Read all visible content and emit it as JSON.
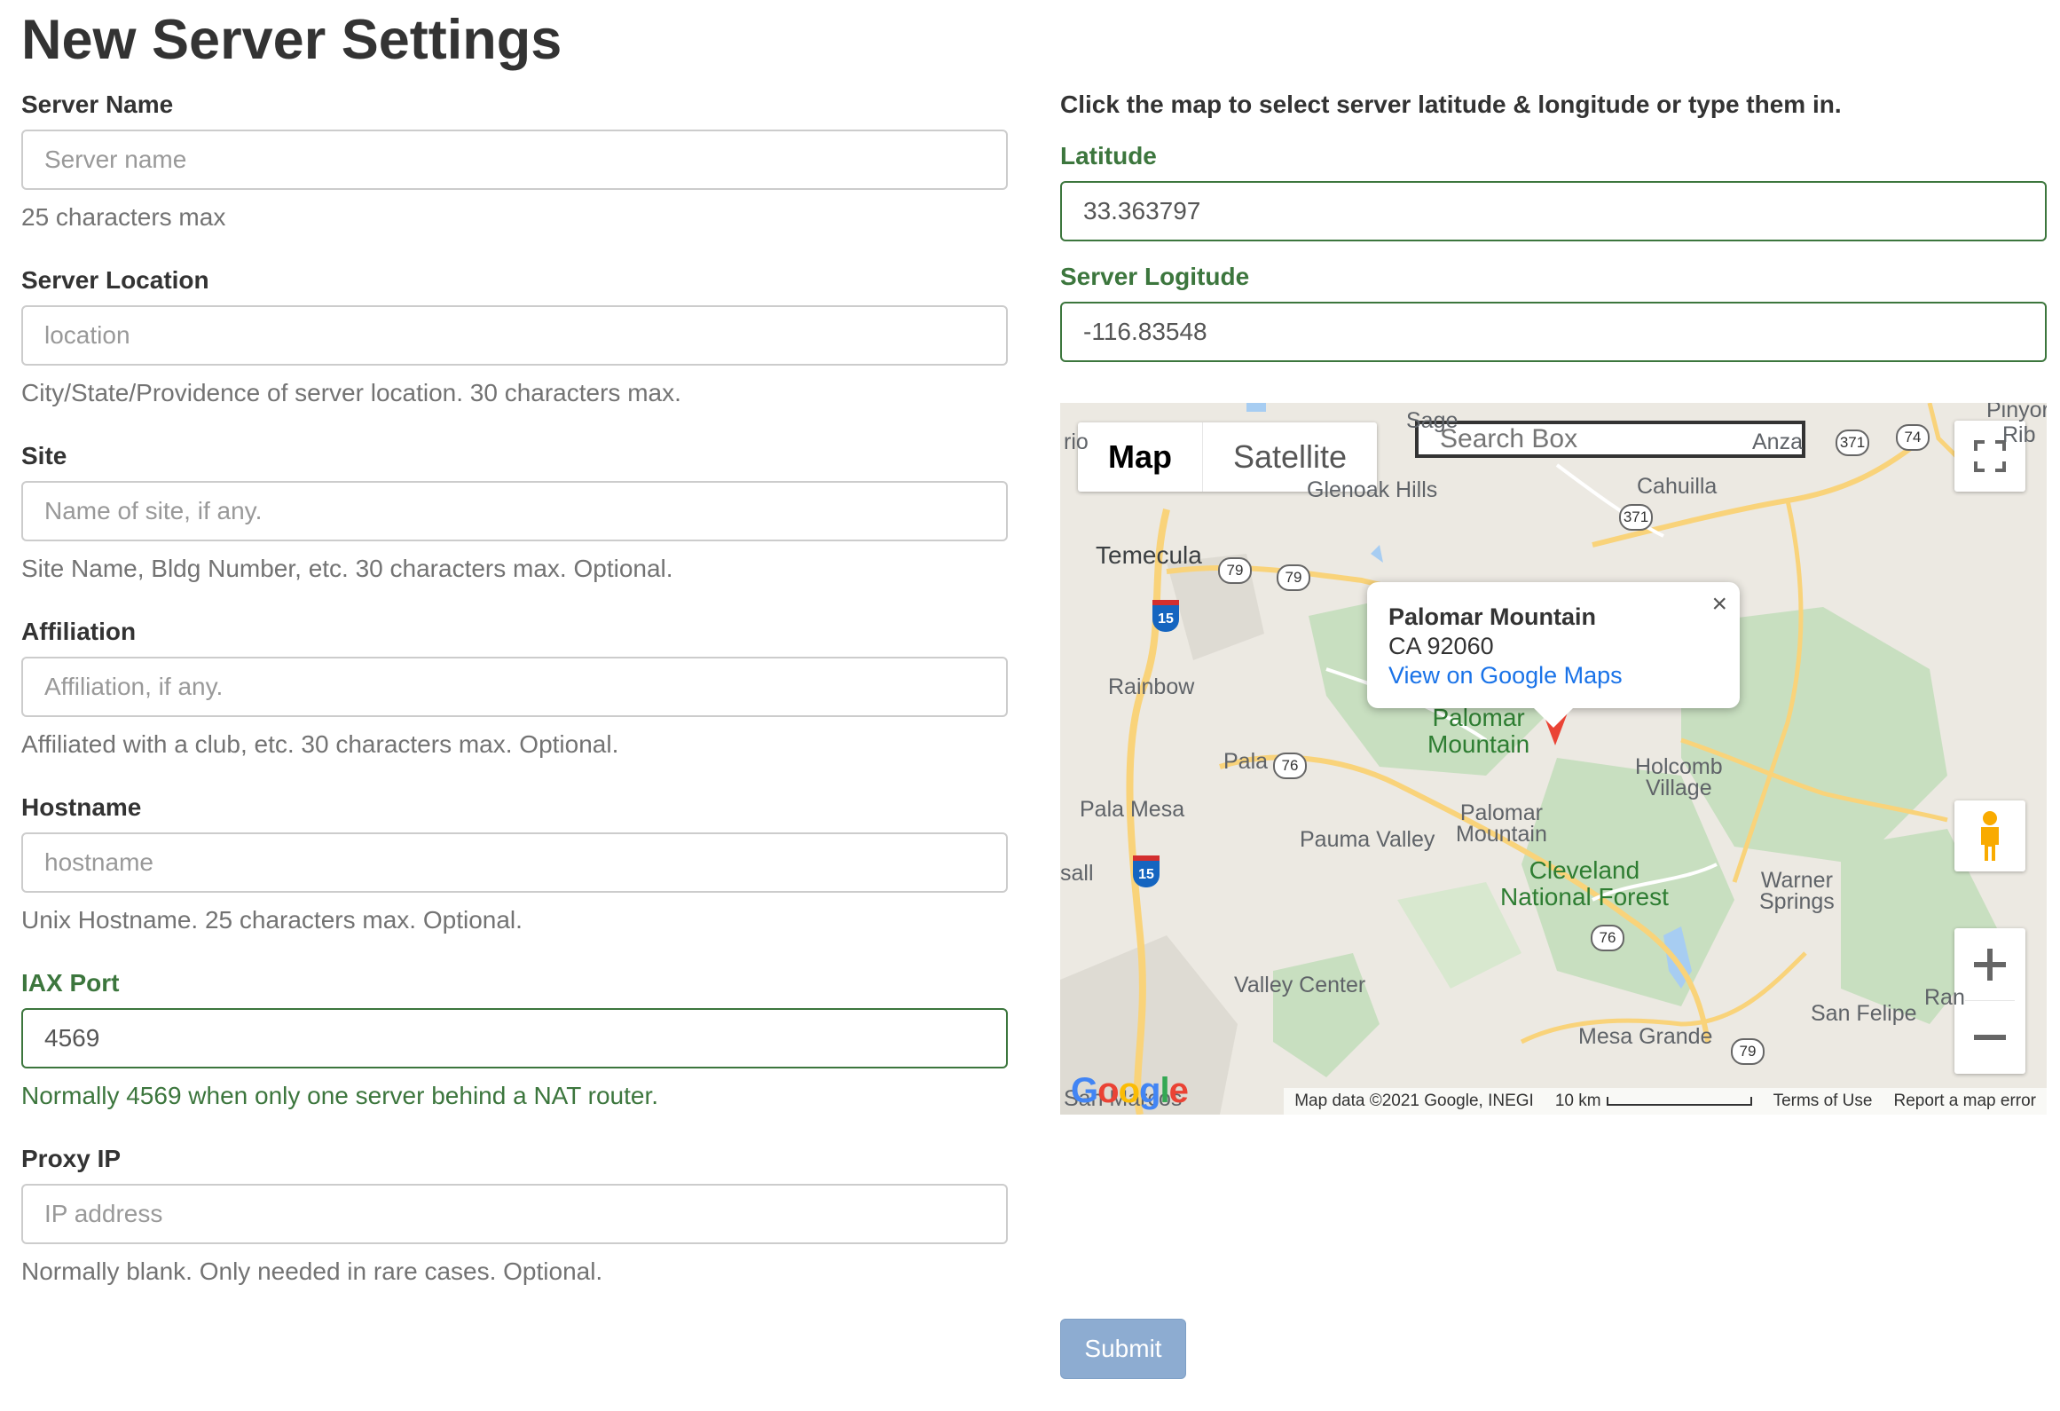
{
  "page": {
    "title": "New Server Settings"
  },
  "form": {
    "server_name": {
      "label": "Server Name",
      "placeholder": "Server name",
      "help": "25 characters max"
    },
    "server_location": {
      "label": "Server Location",
      "placeholder": "location",
      "help": "City/State/Providence of server location. 30 characters max."
    },
    "site": {
      "label": "Site",
      "placeholder": "Name of site, if any.",
      "help": "Site Name, Bldg Number, etc. 30 characters max. Optional."
    },
    "affiliation": {
      "label": "Affiliation",
      "placeholder": "Affiliation, if any.",
      "help": "Affiliated with a club, etc. 30 characters max. Optional."
    },
    "hostname": {
      "label": "Hostname",
      "placeholder": "hostname",
      "help": "Unix Hostname. 25 characters max. Optional."
    },
    "iax_port": {
      "label": "IAX Port",
      "value": "4569",
      "help": "Normally 4569 when only one server behind a NAT router."
    },
    "proxy_ip": {
      "label": "Proxy IP",
      "placeholder": "IP address",
      "help": "Normally blank. Only needed in rare cases. Optional."
    },
    "submit_label": "Submit"
  },
  "map_panel": {
    "intro": "Click the map to select server latitude & longitude or type them in.",
    "latitude": {
      "label": "Latitude",
      "value": "33.363797"
    },
    "longitude": {
      "label": "Server Logitude",
      "value": "-116.83548"
    }
  },
  "map": {
    "type_map": "Map",
    "type_satellite": "Satellite",
    "search_placeholder": "Search Box",
    "infowindow": {
      "name": "Palomar Mountain",
      "address": "CA 92060",
      "link": "View on Google Maps",
      "close": "×"
    },
    "labels": {
      "temecula": "Temecula",
      "cahuilla": "Cahuilla",
      "anza": "Anza",
      "sage": "Sage",
      "glenoak": "Glenoak Hills",
      "rainbow": "Rainbow",
      "pala": "Pala",
      "pala_mesa": "Pala Mesa",
      "palomar_mountain_1": "Palomar",
      "palomar_mountain_2": "Mountain",
      "palomar_small_1": "Palomar",
      "palomar_small_2": "Mountain",
      "holcomb_1": "Holcomb",
      "holcomb_2": "Village",
      "pauma_valley": "Pauma Valley",
      "cleveland_1": "Cleveland",
      "cleveland_2": "National Forest",
      "warner_1": "Warner",
      "warner_2": "Springs",
      "valley_center": "Valley Center",
      "san_felipe": "San Felipe",
      "mesa_grande": "Mesa Grande",
      "san_marcos": "San Marcos",
      "ribbonwood": "Rib",
      "pinyon": "Pinyor",
      "ran": "Ran",
      "rio": "rio",
      "sall": "sall"
    },
    "routes": {
      "r79a": "79",
      "r79b": "79",
      "r79c": "79",
      "r76a": "76",
      "r76b": "76",
      "r371a": "371",
      "r371b": "371",
      "r74": "74",
      "i15a": "15",
      "i15b": "15"
    },
    "footer": {
      "google": "Google",
      "attribution": "Map data ©2021 Google, INEGI",
      "scale": "10 km",
      "terms": "Terms of Use",
      "report": "Report a map error"
    },
    "colors": {
      "forest": "#c8dfc0",
      "road": "#f9d37a",
      "water": "#a7cdf2",
      "land": "#ece9e2",
      "marker": "#ea4335"
    }
  }
}
